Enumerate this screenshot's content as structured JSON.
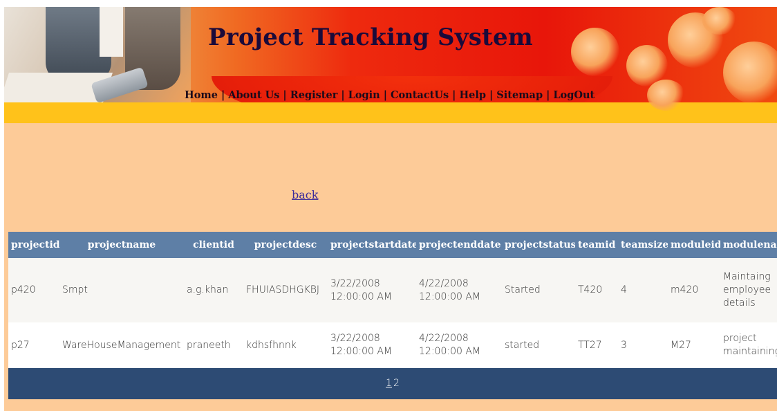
{
  "header": {
    "title": "Project Tracking System",
    "nav": [
      "Home",
      "About Us",
      "Register",
      "Login",
      "ContactUs",
      "Help",
      "Sitemap",
      "LogOut"
    ],
    "separator": "|"
  },
  "content": {
    "back_label": "back"
  },
  "table": {
    "columns": [
      "projectid",
      "projectname",
      "clientid",
      "projectdesc",
      "projectstartdate",
      "projectenddate",
      "projectstatus",
      "teamid",
      "teamsize",
      "moduleid",
      "modulena"
    ],
    "rows": [
      {
        "projectid": "p420",
        "projectname": "Smpt",
        "clientid": "a.g.khan",
        "projectdesc": "FHUIASDHGKBJ",
        "projectstartdate": "3/22/2008 12:00:00 AM",
        "projectenddate": "4/22/2008 12:00:00 AM",
        "projectstatus": "Started",
        "teamid": "T420",
        "teamsize": "4",
        "moduleid": "m420",
        "modulename": "Maintaing employee details"
      },
      {
        "projectid": "p27",
        "projectname": "WareHouseManagement",
        "clientid": "praneeth",
        "projectdesc": "kdhsfhnnk",
        "projectstartdate": "3/22/2008 12:00:00 AM",
        "projectenddate": "4/22/2008 12:00:00 AM",
        "projectstatus": "started",
        "teamid": "TT27",
        "teamsize": "3",
        "moduleid": "M27",
        "modulename": "project maintaining"
      }
    ],
    "pager": [
      "1",
      "2"
    ],
    "current_page": "1"
  }
}
